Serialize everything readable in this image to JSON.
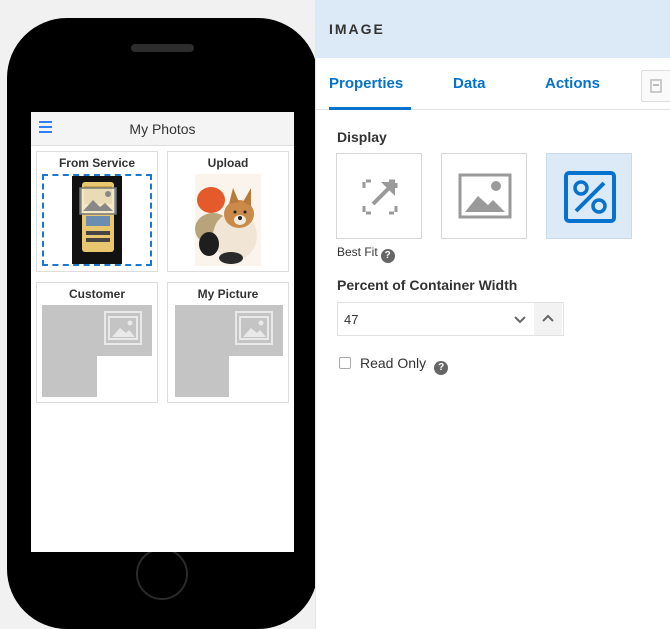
{
  "phone": {
    "header_title": "My Photos",
    "cards": [
      {
        "title": "From Service",
        "image": "service-device-image"
      },
      {
        "title": "Upload",
        "image": "puppy-photo"
      },
      {
        "title": "Customer",
        "image": "image-placeholder"
      },
      {
        "title": "My Picture",
        "image": "image-placeholder"
      }
    ]
  },
  "panel": {
    "title": "IMAGE",
    "tabs": [
      "Properties",
      "Data",
      "Actions"
    ],
    "active_tab": "Properties",
    "display_label": "Display",
    "display_options": [
      {
        "name": "best-fit",
        "icon": "expand-icon",
        "active": false
      },
      {
        "name": "original",
        "icon": "image-icon",
        "active": false
      },
      {
        "name": "percent",
        "icon": "percent-icon",
        "active": true
      }
    ],
    "best_fit_label": "Best Fit",
    "percent_label": "Percent of Container Width",
    "percent_value": "47",
    "read_only_label": "Read Only",
    "read_only_checked": false
  },
  "colors": {
    "accent": "#0572ce",
    "header_bg": "#dce9f7",
    "placeholder": "#c4c4c4"
  }
}
